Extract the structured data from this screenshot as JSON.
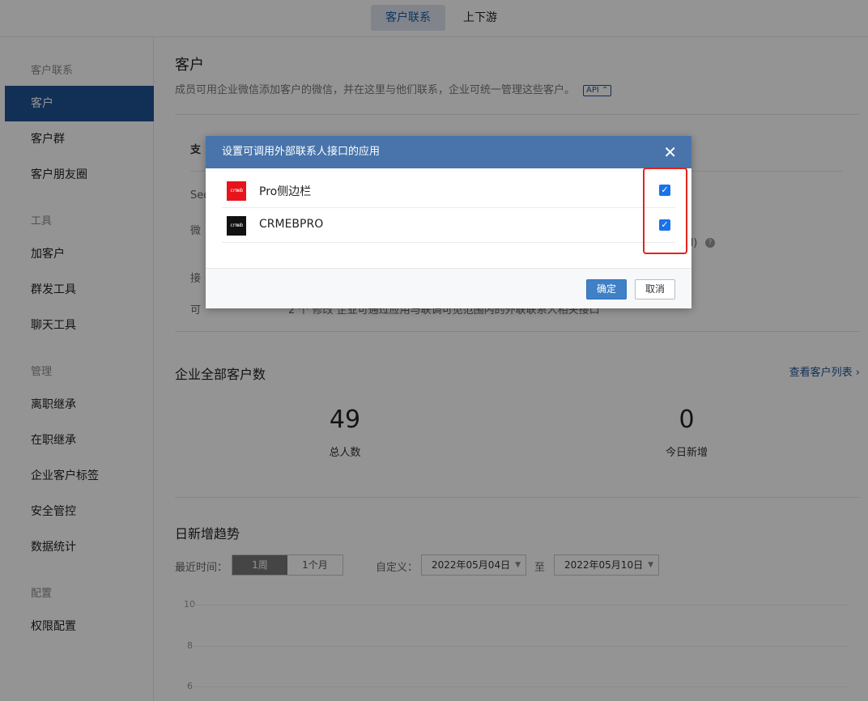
{
  "topbar": {
    "tabs": [
      "客户联系",
      "上下游"
    ]
  },
  "sidebar": {
    "groups": [
      {
        "title": "客户联系",
        "items": [
          "客户",
          "客户群",
          "客户朋友圈"
        ]
      },
      {
        "title": "工具",
        "items": [
          "加客户",
          "群发工具",
          "聊天工具"
        ]
      },
      {
        "title": "管理",
        "items": [
          "离职继承",
          "在职继承",
          "企业客户标签",
          "安全管控",
          "数据统计"
        ]
      },
      {
        "title": "配置",
        "items": [
          "权限配置"
        ]
      }
    ]
  },
  "main": {
    "title": "客户",
    "desc": "成员可用企业微信添加客户的微信，并在这里与他们联系，企业可统一管理这些客户。",
    "api_tag": "API ⌃",
    "ghost": {
      "g1": "支",
      "g2": "Sec",
      "g3": "微",
      "g4": "d)",
      "g5": "接",
      "g6": "可",
      "g7": "2 个 修改    企业可通过应用与联调可见范围内的外联联系人相关接口"
    },
    "stats": {
      "title": "企业全部客户数",
      "link": "查看客户列表 ›",
      "total_value": "49",
      "total_label": "总人数",
      "new_value": "0",
      "new_label": "今日新增"
    },
    "trend": {
      "title": "日新增趋势",
      "recent_label": "最近时间：",
      "seg_week": "1周",
      "seg_month": "1个月",
      "custom_label": "自定义：",
      "start_date": "2022年05月04日",
      "to_label": "至",
      "end_date": "2022年05月10日",
      "arrow": "▼",
      "y_ticks": [
        "10",
        "8",
        "6"
      ]
    }
  },
  "dialog": {
    "title": "设置可调用外部联系人接口的应用",
    "close": "✕",
    "apps": [
      {
        "name": "Pro侧边栏",
        "logo_text": "crmeb",
        "logo_bg": "#e8141c",
        "checked": true
      },
      {
        "name": "CRMEBPRO",
        "logo_text": "crmeb",
        "logo_bg": "#111111",
        "checked": true
      }
    ],
    "check_mark": "✓",
    "ok_label": "确定",
    "cancel_label": "取消"
  }
}
